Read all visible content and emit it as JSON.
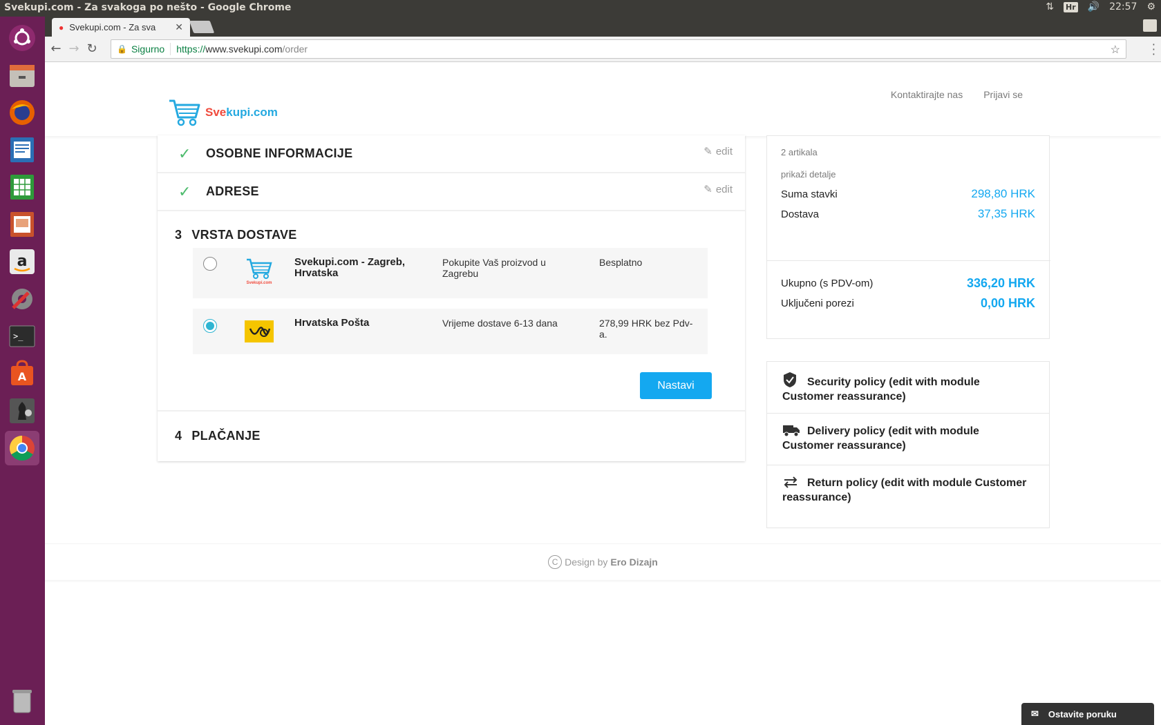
{
  "os": {
    "window_title": "Svekupi.com - Za svakoga po nešto - Google Chrome",
    "keyboard_layout": "Hr",
    "clock": "22:57"
  },
  "launcher": {
    "icons": [
      "ubuntu-dash-icon",
      "files-icon",
      "firefox-icon",
      "writer-icon",
      "calc-icon",
      "impress-icon",
      "amazon-icon",
      "settings-icon",
      "terminal-icon",
      "software-center-icon",
      "chess-icon",
      "chrome-icon",
      "trash-icon"
    ]
  },
  "browser": {
    "tab_title": "Svekupi.com - Za sva",
    "security_label": "Sigurno",
    "url_scheme": "https://",
    "url_host": "www.svekupi.com",
    "url_path": "/order"
  },
  "header": {
    "brand_part1": "Sve",
    "brand_part2": "kupi.com",
    "links": [
      "Kontaktirajte nas",
      "Prijavi se"
    ]
  },
  "checkout": {
    "step1_title": "OSOBNE INFORMACIJE",
    "step2_title": "ADRESE",
    "edit_label": "edit",
    "step3_number": "3",
    "step3_title": "VRSTA DOSTAVE",
    "carriers": [
      {
        "name": "Svekupi.com - Zagreb, Hrvatska",
        "delay": "Pokupite Vaš proizvod u Zagrebu",
        "price": "Besplatno",
        "selected": false,
        "logo_text": "Svekupi.com"
      },
      {
        "name": "Hrvatska Pošta",
        "delay": "Vrijeme dostave 6-13 dana",
        "price": "278,99 HRK bez Pdv-a.",
        "selected": true
      }
    ],
    "continue_label": "Nastavi",
    "step4_number": "4",
    "step4_title": "PLAČANJE"
  },
  "summary": {
    "items_count": "2 artikala",
    "show_details": "prikaži detalje",
    "subtotal_label": "Suma stavki",
    "subtotal_value": "298,80 HRK",
    "shipping_label": "Dostava",
    "shipping_value": "37,35 HRK",
    "total_label": "Ukupno (s PDV-om)",
    "total_value": "336,20 HRK",
    "tax_label": "Uključeni porezi",
    "tax_value": "0,00 HRK"
  },
  "reassurance": [
    {
      "icon": "shield-icon",
      "text": "Security policy (edit with module Customer reassurance)"
    },
    {
      "icon": "truck-icon",
      "text": "Delivery policy (edit with module Customer reassurance)"
    },
    {
      "icon": "arrows-swap-icon",
      "text": "Return policy (edit with module Customer reassurance)"
    }
  ],
  "footer": {
    "copyright_symbol": "C",
    "design_by": "Design by",
    "designer": "Ero Dizajn"
  },
  "chat": {
    "label": "Ostavite poruku"
  },
  "colors": {
    "accent": "#14a8f0",
    "check": "#4cbb6c",
    "brand_red": "#f04a3c",
    "launcher": "#6b1f55"
  }
}
